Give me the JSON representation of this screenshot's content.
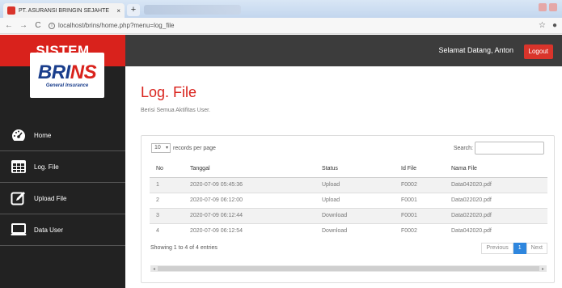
{
  "browser": {
    "tab_title": "PT. ASURANSI BRINGIN SEJAHTE",
    "tab_close": "×",
    "new_tab": "+",
    "url": "localhost/brins/home.php?menu=log_file"
  },
  "sidebar": {
    "brand": "SISTEM",
    "logo_text_a": "BRI",
    "logo_text_b": "NS",
    "logo_sub": "General Insurance",
    "items": [
      {
        "label": "Home",
        "icon": "dashboard-icon"
      },
      {
        "label": "Log. File",
        "icon": "table-icon"
      },
      {
        "label": "Upload File",
        "icon": "edit-icon"
      },
      {
        "label": "Data User",
        "icon": "monitor-icon"
      }
    ]
  },
  "topbar": {
    "welcome": "Selamat Datang, Anton",
    "logout": "Logout"
  },
  "page": {
    "title": "Log. File",
    "subtitle": "Berisi Semua Aktifitas User."
  },
  "table": {
    "length_value": "10",
    "length_suffix": "records per page",
    "search_label": "Search:",
    "columns": [
      "No",
      "Tanggal",
      "Status",
      "Id File",
      "Nama File"
    ],
    "rows": [
      [
        "1",
        "2020-07-09 05:45:36",
        "Upload",
        "F0002",
        "Data042020.pdf"
      ],
      [
        "2",
        "2020-07-09 06:12:00",
        "Upload",
        "F0001",
        "Data022020.pdf"
      ],
      [
        "3",
        "2020-07-09 06:12:44",
        "Download",
        "F0001",
        "Data022020.pdf"
      ],
      [
        "4",
        "2020-07-09 06:12:54",
        "Download",
        "F0002",
        "Data042020.pdf"
      ]
    ],
    "info": "Showing 1 to 4 of 4 entries",
    "prev": "Previous",
    "page": "1",
    "next": "Next"
  },
  "colors": {
    "brand_red": "#d9221c",
    "sidebar_bg": "#222222",
    "topbar_bg": "#3c3c3c",
    "pager_active": "#2e86de"
  }
}
